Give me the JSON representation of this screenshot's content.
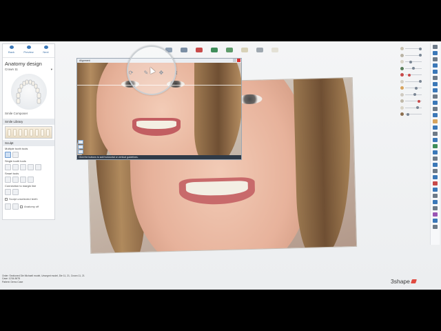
{
  "navigation": {
    "back_label": "Back",
    "preview_label": "Preview",
    "next_label": "Next"
  },
  "panel": {
    "title": "Anatomy design",
    "crown_label": "Crown 11",
    "smile_composer_label": "Smile Composer",
    "smile_library_label": "Smile Library",
    "sculpt_label": "Sculpt",
    "multiple_tools_label": "Multiple tooth tools",
    "single_tools_label": "Single tooth tools",
    "smart_tools_label": "Smart tools",
    "connection_label": "Connection to margin line",
    "sculpt_unselect_label": "Sculpt unselected teeth",
    "anatomy_off_label": "Anatomy off"
  },
  "dialog": {
    "title": "Alignment",
    "status_text": "Click the buttons to add horizontal or vertical guidelines."
  },
  "info": {
    "order_line": "Order:       Sectioned Die Michaell model, Unsegmt model, Die 11, 21, Crown 11, 21",
    "case_line": "Case:        1234-5678",
    "patient_line": "Patient:     Demo Case"
  },
  "branding": {
    "logo_text": "3shape"
  },
  "colors": {
    "accent_blue": "#3b78b8",
    "status_bar": "#2f3a47",
    "close_red": "#dd3333",
    "brand_red": "#e04b41"
  },
  "icons": [
    "back-icon",
    "preview-icon",
    "next-icon",
    "refresh-icon",
    "pencil-icon",
    "brush-icon",
    "model-icon",
    "scan-icon",
    "close-icon"
  ]
}
